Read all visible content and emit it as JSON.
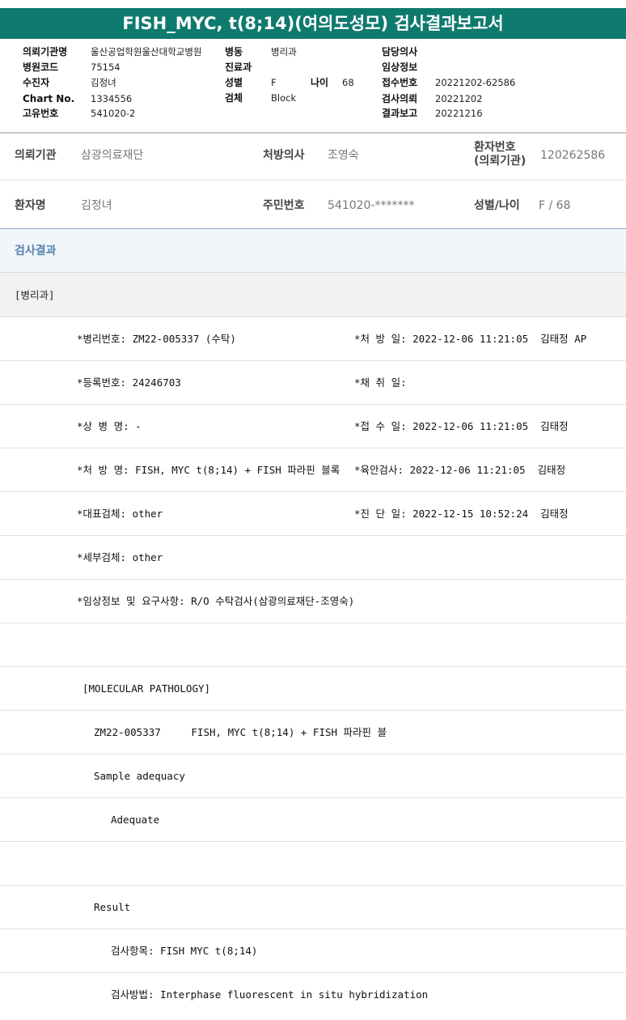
{
  "title": "FISH_MYC, t(8;14)(여의도성모) 검사결과보고서",
  "header": {
    "org_label": "의뢰기관명",
    "org_value": "울산공업학원울산대학교병원",
    "code_label": "병원코드",
    "code_value": "75154",
    "patient_label": "수진자",
    "patient_value": "김정녀",
    "chart_label": "Chart No.",
    "chart_value": "1334556",
    "unique_label": "고유번호",
    "unique_value": "541020-2",
    "ward_label": "병동",
    "ward_value": "병리과",
    "dept_label": "진료과",
    "dept_value": "",
    "sex_label": "성별",
    "sex_value": "F",
    "age_label": "나이",
    "age_value": "68",
    "specimen_label": "검체",
    "specimen_value": "Block",
    "doctor_label": "담당의사",
    "doctor_value": "",
    "clinical_label": "임상정보",
    "clinical_value": "",
    "receipt_label": "접수번호",
    "receipt_value": "20221202-62586",
    "request_label": "검사의뢰",
    "request_value": "20221202",
    "report_label": "결과보고",
    "report_value": "20221216"
  },
  "patient_info": {
    "institution_label": "의뢰기관",
    "institution_value": "삼광의료재단",
    "physician_label": "처방의사",
    "physician_value": "조영숙",
    "patient_no_label_1": "환자번호",
    "patient_no_label_2": "(의뢰기관)",
    "patient_no_value": "120262586",
    "name_label": "환자명",
    "name_value": "김정녀",
    "resident_label": "주민번호",
    "resident_value": "541020-*******",
    "sex_age_label": "성별/나이",
    "sex_age_value": "F / 68"
  },
  "results": {
    "section_title": "검사결과",
    "department": "[병리과]",
    "lines": [
      {
        "left": "*병리번호: ZM22-005337 (수탁)",
        "right": "*처 방 일: 2022-12-06 11:21:05  김태정 AP"
      },
      {
        "left": "*등록번호: 24246703",
        "right": "*채 취 일:"
      },
      {
        "left": "*상 병 명: -",
        "right": "*접 수 일: 2022-12-06 11:21:05  김태정"
      },
      {
        "left": "*처 방 명: FISH, MYC t(8;14) + FISH 파라핀 블록",
        "right": "*육안검사: 2022-12-06 11:21:05  김태정"
      },
      {
        "left": "*대표검체: other",
        "right": "*진 단 일: 2022-12-15 10:52:24  김태정"
      },
      {
        "left": "*세부검체: other",
        "right": ""
      },
      {
        "left": "*임상정보 및 요구사항: R/O 수탁검사(삼광의료재단-조영숙)",
        "right": ""
      },
      {
        "left": "",
        "right": ""
      },
      {
        "left": "[MOLECULAR PATHOLOGY]",
        "right": ""
      },
      {
        "left": "ZM22-005337     FISH, MYC t(8;14) + FISH 파라핀 블",
        "right": ""
      },
      {
        "left": "Sample adequacy",
        "right": ""
      },
      {
        "left": "Adequate",
        "right": ""
      },
      {
        "left": "",
        "right": ""
      },
      {
        "left": "Result",
        "right": ""
      },
      {
        "left": "검사항목: FISH MYC t(8;14)",
        "right": ""
      },
      {
        "left": "검사방법: Interphase fluorescent in situ hybridization",
        "right": ""
      }
    ]
  }
}
